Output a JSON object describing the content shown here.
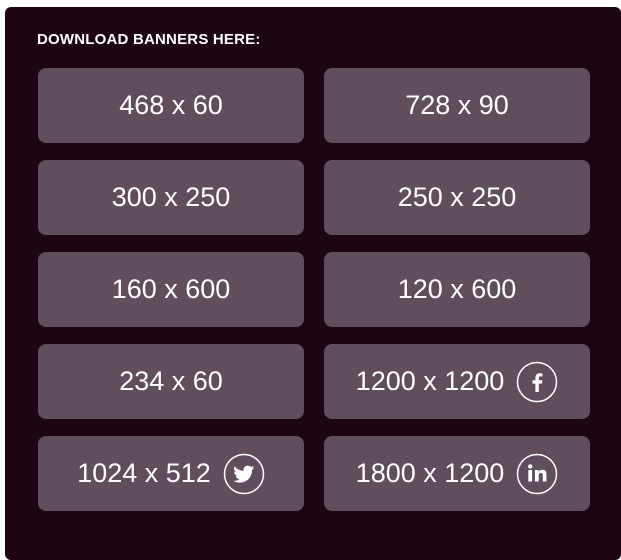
{
  "heading": "DOWNLOAD BANNERS HERE:",
  "colors": {
    "panel_background": "#1e0513",
    "button_background": "#604e5d",
    "text": "#ffffff"
  },
  "banners": [
    {
      "label": "468 x 60"
    },
    {
      "label": "728 x 90"
    },
    {
      "label": "300 x 250"
    },
    {
      "label": "250 x 250"
    },
    {
      "label": "160 x 600"
    },
    {
      "label": "120 x 600"
    },
    {
      "label": "234 x 60"
    },
    {
      "label": "1200 x 1200",
      "icon": "facebook-icon"
    },
    {
      "label": "1024 x 512",
      "icon": "twitter-icon"
    },
    {
      "label": "1800 x 1200",
      "icon": "linkedin-icon"
    }
  ]
}
